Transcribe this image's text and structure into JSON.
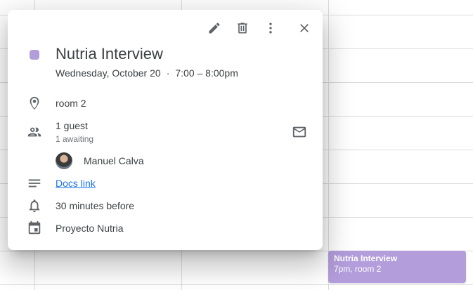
{
  "event": {
    "title": "Nutria Interview",
    "date": "Wednesday, October 20",
    "separator": "·",
    "time": "7:00 – 8:00pm",
    "color": "#b39ddb",
    "location": "room 2",
    "guests_summary": "1 guest",
    "guests_status": "1 awaiting",
    "guest_name": "Manuel Calva",
    "description_link": "Docs link",
    "reminder": "30 minutes before",
    "calendar": "Proyecto Nutria"
  },
  "toolbar": {
    "icons": [
      "edit-icon",
      "delete-icon",
      "more-options-icon",
      "close-icon"
    ]
  },
  "chip": {
    "title": "Nutria Interview",
    "details": "7pm, room 2"
  }
}
